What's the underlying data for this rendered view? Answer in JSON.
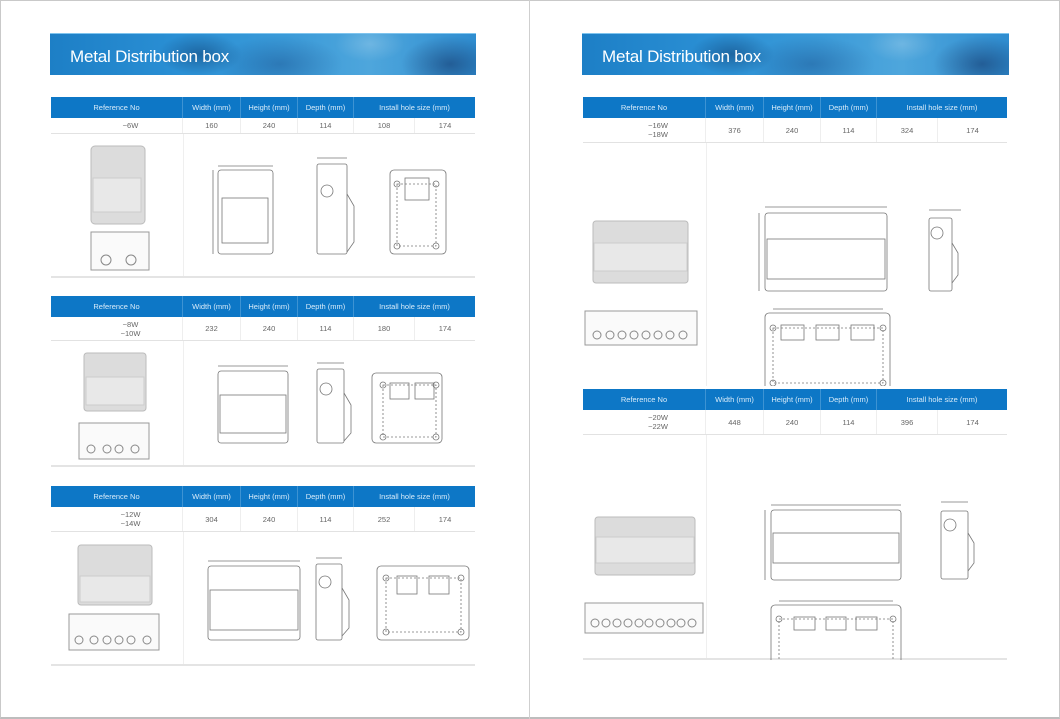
{
  "pages": [
    {
      "title": "Metal Distribution box",
      "sections": [
        {
          "headers": {
            "reference": "Reference  No",
            "width": "Width (mm)",
            "height": "Height (mm)",
            "depth": "Depth (mm)",
            "install": "Install hole size (mm)"
          },
          "refs": [
            "~6W"
          ],
          "width": "160",
          "height": "240",
          "depth": "114",
          "hole_a": "108",
          "hole_b": "174"
        },
        {
          "headers": {
            "reference": "Reference  No",
            "width": "Width (mm)",
            "height": "Height (mm)",
            "depth": "Depth (mm)",
            "install": "Install hole size (mm)"
          },
          "refs": [
            "~8W",
            "~10W"
          ],
          "width": "232",
          "height": "240",
          "depth": "114",
          "hole_a": "180",
          "hole_b": "174"
        },
        {
          "headers": {
            "reference": "Reference  No",
            "width": "Width (mm)",
            "height": "Height (mm)",
            "depth": "Depth (mm)",
            "install": "Install hole size (mm)"
          },
          "refs": [
            "~12W",
            "~14W"
          ],
          "width": "304",
          "height": "240",
          "depth": "114",
          "hole_a": "252",
          "hole_b": "174"
        }
      ]
    },
    {
      "title": "Metal Distribution box",
      "sections": [
        {
          "headers": {
            "reference": "Reference  No",
            "width": "Width (mm)",
            "height": "Height (mm)",
            "depth": "Depth (mm)",
            "install": "Install hole size (mm)"
          },
          "refs": [
            "~16W",
            "~18W"
          ],
          "width": "376",
          "height": "240",
          "depth": "114",
          "hole_a": "324",
          "hole_b": "174"
        },
        {
          "headers": {
            "reference": "Reference  No",
            "width": "Width (mm)",
            "height": "Height (mm)",
            "depth": "Depth (mm)",
            "install": "Install hole size (mm)"
          },
          "refs": [
            "~20W",
            "~22W"
          ],
          "width": "448",
          "height": "240",
          "depth": "114",
          "hole_a": "396",
          "hole_b": "174"
        }
      ]
    }
  ],
  "colors": {
    "header_blue": "#0d77c6",
    "banner_blue": "#2a8fd4"
  }
}
